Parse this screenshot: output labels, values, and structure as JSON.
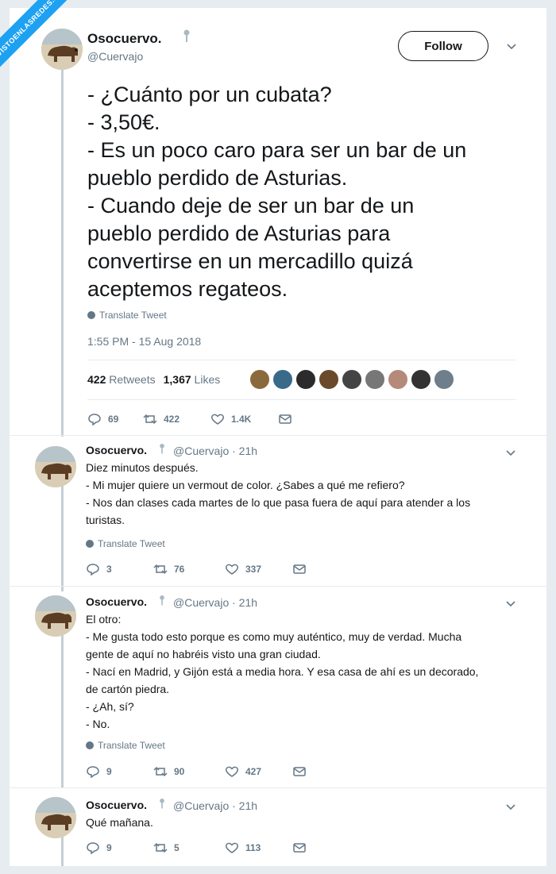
{
  "watermark": "VISTOENLASREDES.com",
  "main_tweet": {
    "name": "Osocuervo.",
    "handle": "@Cuervajo",
    "follow_label": "Follow",
    "text_lines": [
      "- ¿Cuánto por un cubata?",
      "- 3,50€.",
      "- Es un poco caro para ser un bar de un",
      "pueblo perdido de Asturias.",
      "- Cuando deje de ser un bar de un",
      "pueblo perdido de Asturias para",
      "convertirse en un mercadillo quizá",
      "aceptemos regateos."
    ],
    "translate": "Translate Tweet",
    "timestamp": "1:55 PM - 15 Aug 2018",
    "retweets_count": "422",
    "retweets_label": "Retweets",
    "likes_count": "1,367",
    "likes_label": "Likes",
    "actions": {
      "replies": "69",
      "retweets": "422",
      "likes": "1.4K"
    }
  },
  "replies": [
    {
      "name": "Osocuervo.",
      "handle_time": "@Cuervajo · 21h",
      "lines": [
        "Diez minutos después.",
        "- Mi mujer quiere un vermout de color. ¿Sabes a qué me refiero?",
        "- Nos dan clases cada martes de lo que pasa fuera de aquí para atender a los",
        "turistas."
      ],
      "translate": "Translate Tweet",
      "actions": {
        "replies": "3",
        "retweets": "76",
        "likes": "337"
      }
    },
    {
      "name": "Osocuervo.",
      "handle_time": "@Cuervajo · 21h",
      "lines": [
        "El otro:",
        "- Me gusta todo esto porque es como muy auténtico, muy de verdad. Mucha",
        "gente de aquí no habréis visto una gran ciudad.",
        "- Nací en Madrid, y Gijón está a media hora. Y esa casa de ahí es un decorado,",
        "de cartón piedra.",
        "- ¿Ah, sí?",
        "- No."
      ],
      "translate": "Translate Tweet",
      "actions": {
        "replies": "9",
        "retweets": "90",
        "likes": "427"
      }
    },
    {
      "name": "Osocuervo.",
      "handle_time": "@Cuervajo · 21h",
      "lines": [
        "Qué mañana."
      ],
      "actions": {
        "replies": "9",
        "retweets": "5",
        "likes": "113"
      }
    }
  ],
  "colors": {
    "accent": "#1da1f2",
    "muted": "#657786",
    "line": "#c4cfd6"
  }
}
